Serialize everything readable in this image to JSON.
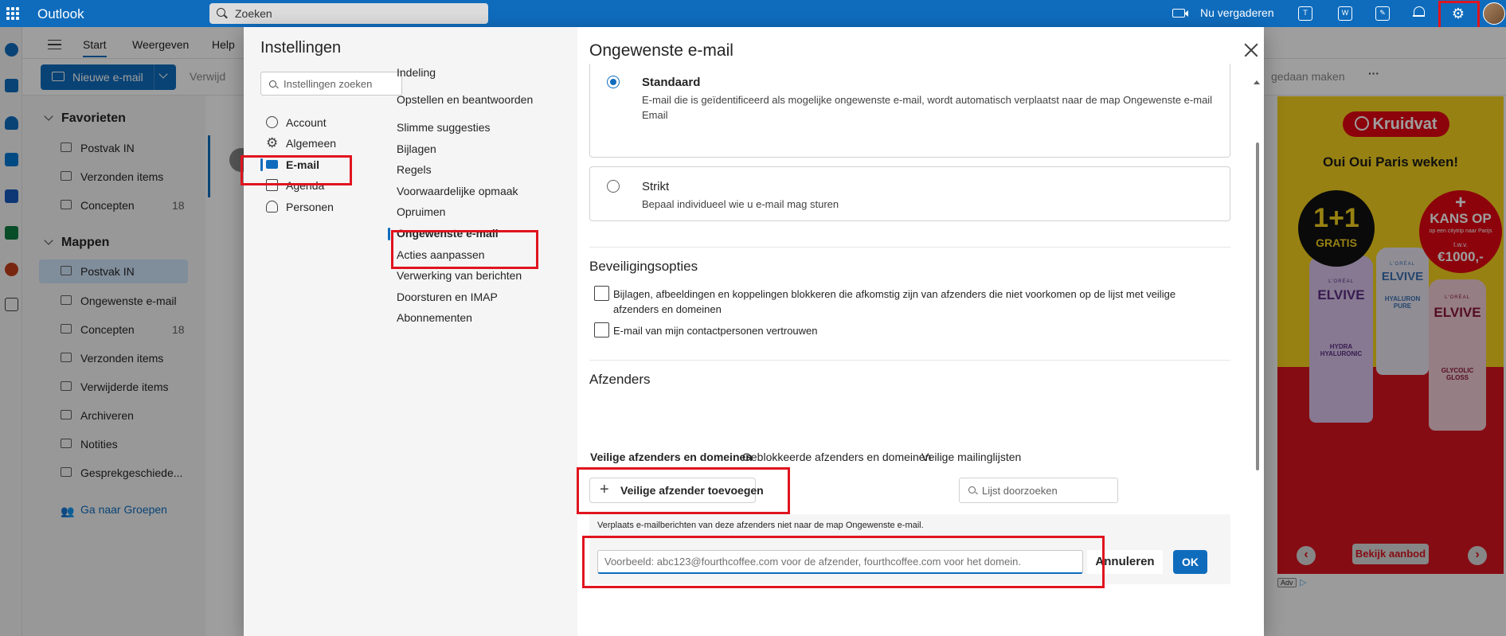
{
  "topbar": {
    "app_title": "Outlook",
    "search_placeholder": "Zoeken",
    "meet_now": "Nu vergaderen"
  },
  "ribbon": {
    "tabs": [
      "Start",
      "Weergeven",
      "Help"
    ],
    "new_mail": "Nieuwe e-mail",
    "delete_partial": "Verwijd",
    "done_partial": "gedaan maken",
    "more": "···"
  },
  "folders": {
    "favorites_header": "Favorieten",
    "favorites": [
      {
        "label": "Postvak IN",
        "count": ""
      },
      {
        "label": "Verzonden items",
        "count": ""
      },
      {
        "label": "Concepten",
        "count": "18"
      }
    ],
    "folders_header": "Mappen",
    "items": [
      {
        "label": "Postvak IN",
        "count": ""
      },
      {
        "label": "Ongewenste e-mail",
        "count": ""
      },
      {
        "label": "Concepten",
        "count": "18"
      },
      {
        "label": "Verzonden items",
        "count": ""
      },
      {
        "label": "Verwijderde items",
        "count": ""
      },
      {
        "label": "Archiveren",
        "count": ""
      },
      {
        "label": "Notities",
        "count": ""
      },
      {
        "label": "Gesprekgeschiede...",
        "count": ""
      }
    ],
    "groups_link": "Ga naar Groepen"
  },
  "ad": {
    "brand": "Kruidvat",
    "slogan": "Oui Oui Paris weken!",
    "badge_left_big": "1+1",
    "badge_left_small": "GRATIS",
    "badge_right_plus": "+",
    "badge_right_l1": "KANS OP",
    "badge_right_l2": "op een citytrip naar Parijs",
    "badge_right_l3": "t.w.v.",
    "badge_right_l4": "€1000,-",
    "bottle1_brand": "ELVIVE",
    "bottle1_sub": "L'ORÉAL",
    "bottle1_desc": "HYDRA HYALURONIC",
    "bottle2_brand": "ELVIVE",
    "bottle2_sub": "L'ORÉAL",
    "bottle2_desc": "HYALURON PURE",
    "bottle3_brand": "ELVIVE",
    "bottle3_sub": "L'ORÉAL",
    "bottle3_desc": "GLYCOLIC GLOSS",
    "cta": "Bekijk aanbod",
    "prev": "‹",
    "next": "›",
    "adv_tag": "Adv"
  },
  "settings": {
    "title": "Instellingen",
    "search_placeholder": "Instellingen zoeken",
    "categories": [
      "Account",
      "Algemeen",
      "E-mail",
      "Agenda",
      "Personen"
    ],
    "subitems": [
      "Indeling",
      "Opstellen en beantwoorden",
      "Slimme suggesties",
      "Bijlagen",
      "Regels",
      "Voorwaardelijke opmaak",
      "Opruimen",
      "Ongewenste e-mail",
      "Acties aanpassen",
      "Verwerking van berichten",
      "Doorsturen en IMAP",
      "Abonnementen"
    ],
    "pane": {
      "title": "Ongewenste e-mail",
      "standard_title": "Standaard",
      "standard_desc": "E-mail die is geïdentificeerd als mogelijke ongewenste e-mail, wordt automatisch verplaatst naar de map Ongewenste e-mail Email",
      "strict_title": "Strikt",
      "strict_desc": "Bepaal individueel wie u e-mail mag sturen",
      "security_title": "Beveiligingsopties",
      "security_opt1": "Bijlagen, afbeeldingen en koppelingen blokkeren die afkomstig zijn van afzenders die niet voorkomen op de lijst met veilige afzenders en domeinen",
      "security_opt2": "E-mail van mijn contactpersonen vertrouwen",
      "senders_title": "Afzenders",
      "sender_tabs": [
        "Veilige afzenders en domeinen",
        "Geblokkeerde afzenders en domeinen",
        "Veilige mailinglijsten"
      ],
      "add_safe_sender": "Veilige afzender toevoegen",
      "list_search_placeholder": "Lijst doorzoeken",
      "info_text": "Verplaats e-mailberichten van deze afzenders niet naar de map Ongewenste e-mail.",
      "email_input_placeholder": "Voorbeeld: abc123@fourthcoffee.com voor de afzender, fourthcoffee.com voor het domein.",
      "email_input_value": "",
      "cancel": "Annuleren",
      "ok": "OK"
    }
  }
}
